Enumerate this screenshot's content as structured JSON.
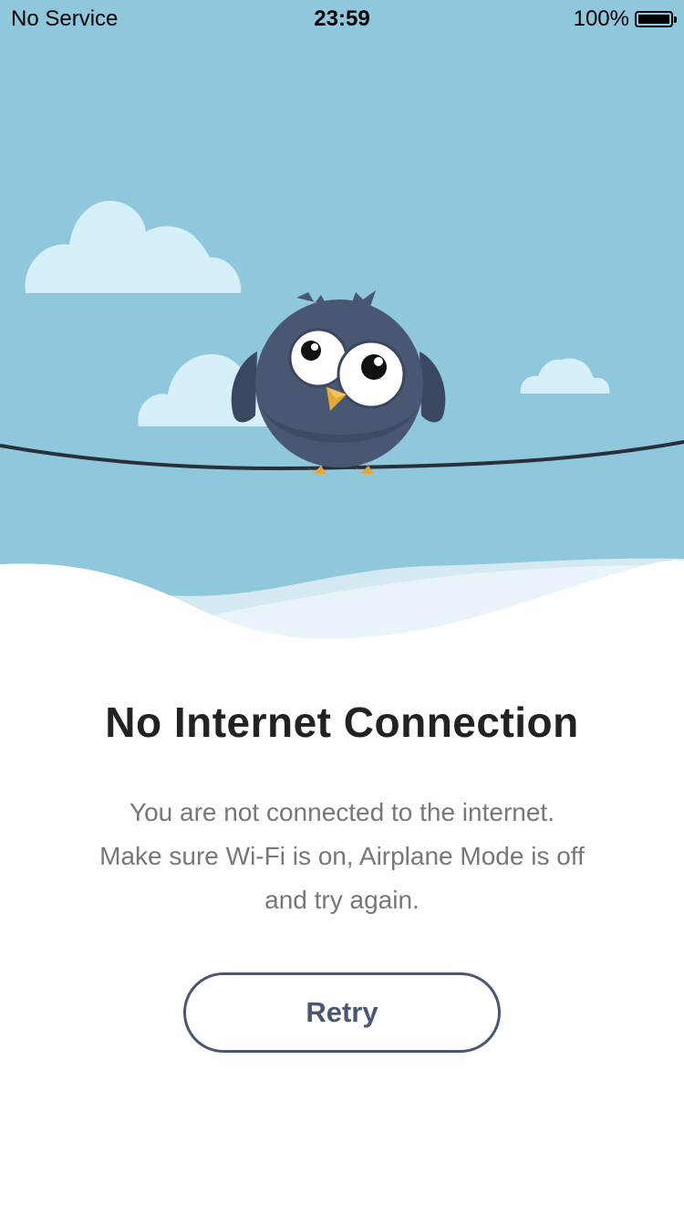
{
  "status_bar": {
    "carrier": "No Service",
    "time": "23:59",
    "battery_percent": "100%",
    "battery_level": 1.0
  },
  "illustration": {
    "subject": "owl-on-wire",
    "colors": {
      "sky": "#8fc8dc",
      "cloud": "#d6f0fa",
      "owl_body": "#4a5772",
      "owl_wing": "#3b4760",
      "beak": "#e3a83a",
      "wire": "#2a2f3a",
      "snow_back": "#d4e9f2",
      "snow_front": "#ffffff"
    }
  },
  "main": {
    "title": "No Internet Connection",
    "message_lines": [
      "You are not connected to the internet.",
      "Make sure Wi-Fi is on, Airplane Mode is off",
      "and try again."
    ],
    "retry_label": "Retry"
  },
  "theme": {
    "accent": "#4a5772",
    "title_color": "#222222",
    "body_color": "#777777"
  }
}
